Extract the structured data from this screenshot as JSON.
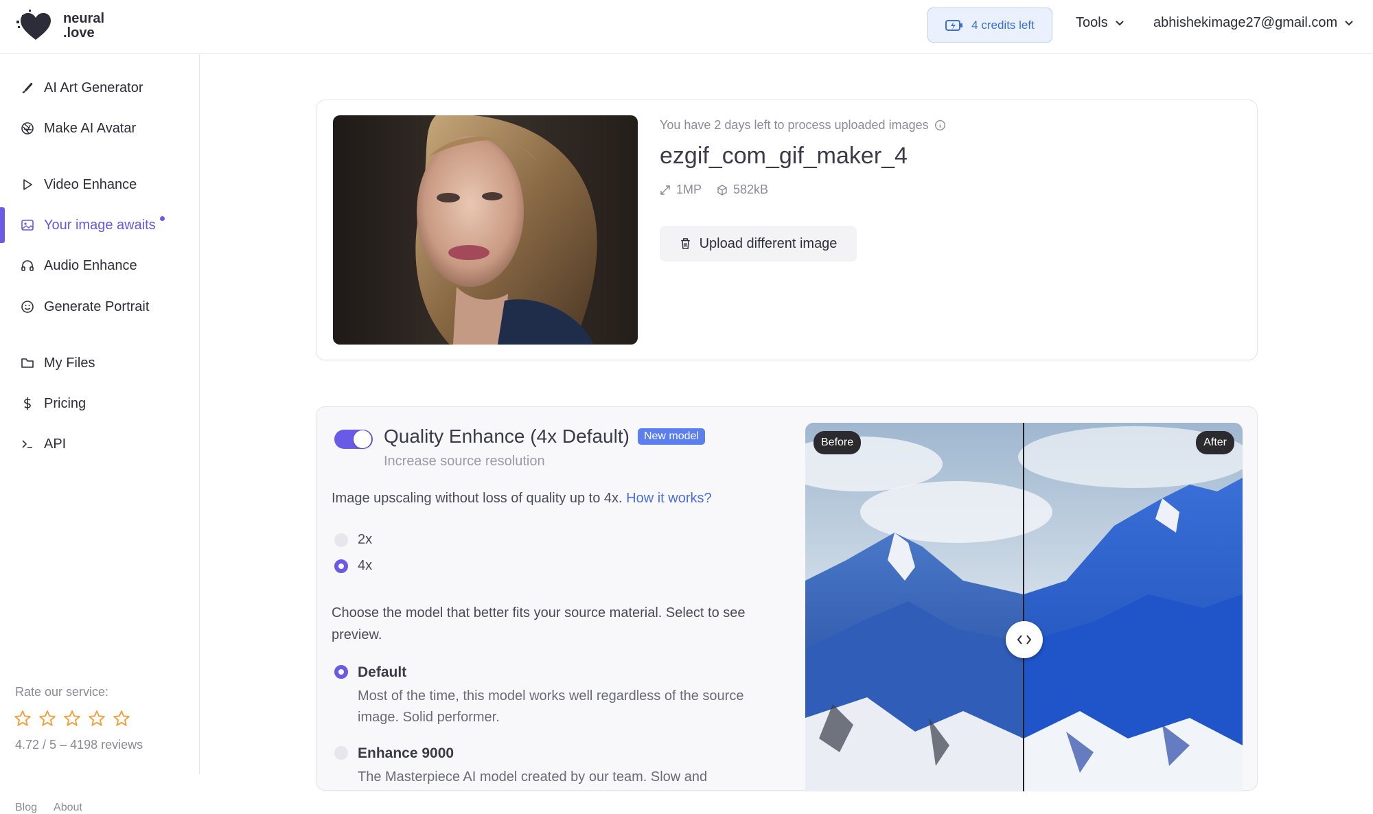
{
  "header": {
    "logo_line1": "neural",
    "logo_line2": ".love",
    "credits_label": "4 credits left",
    "tools_label": "Tools",
    "account_email": "abhishekimage27@gmail.com"
  },
  "sidebar": {
    "items": [
      {
        "label": "AI Art Generator",
        "icon": "brush-icon"
      },
      {
        "label": "Make AI Avatar",
        "icon": "aperture-icon"
      },
      {
        "label": "Video Enhance",
        "icon": "play-icon"
      },
      {
        "label": "Your image awaits",
        "icon": "image-icon",
        "active": true
      },
      {
        "label": "Audio Enhance",
        "icon": "headphones-icon"
      },
      {
        "label": "Generate Portrait",
        "icon": "smile-icon"
      },
      {
        "label": "My Files",
        "icon": "folder-icon"
      },
      {
        "label": "Pricing",
        "icon": "dollar-icon"
      },
      {
        "label": "API",
        "icon": "terminal-icon"
      }
    ],
    "rate_label": "Rate our service:",
    "rating_stars": 5,
    "reviews_text": "4.72 / 5 – 4198 reviews",
    "footer_links": [
      "Blog",
      "About"
    ]
  },
  "upload_card": {
    "days_left": "You have 2 days left to process uploaded images",
    "file_name": "ezgif_com_gif_maker_4",
    "resolution": "1MP",
    "file_size": "582kB",
    "upload_button": "Upload different image"
  },
  "enhance_card": {
    "enabled": true,
    "title": "Quality Enhance (4x Default)",
    "badge": "New model",
    "subtitle": "Increase source resolution",
    "description": "Image upscaling without loss of quality up to 4x.",
    "how_link": "How it works?",
    "scale_options": [
      {
        "label": "2x",
        "selected": false
      },
      {
        "label": "4x",
        "selected": true
      }
    ],
    "choose_text": "Choose the model that better fits your source material. Select to see preview.",
    "models": [
      {
        "title": "Default",
        "selected": true,
        "description": "Most of the time, this model works well regardless of the source image. Solid performer."
      },
      {
        "title": "Enhance 9000",
        "selected": false,
        "description": "The Masterpiece AI model created by our team. Slow and"
      }
    ],
    "before_label": "Before",
    "after_label": "After"
  },
  "colors": {
    "accent": "#6a5ae8",
    "credits_bg": "#eaf1fd",
    "badge": "#5b7ef0",
    "star": "#f0a040"
  }
}
